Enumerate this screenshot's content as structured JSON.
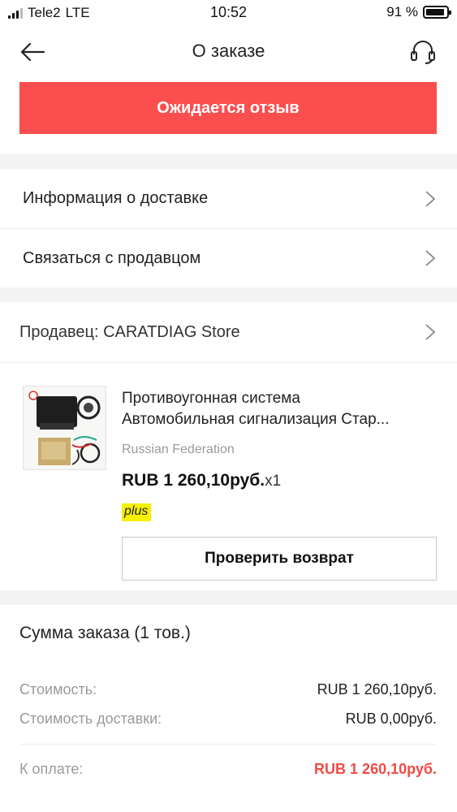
{
  "status_bar": {
    "carrier": "Tele2",
    "network": "LTE",
    "time": "10:52",
    "battery": "91 %",
    "battery_level": 0.91
  },
  "header": {
    "title": "О заказе",
    "back_icon": "arrow-left-icon",
    "support_icon": "headset-icon"
  },
  "order_status": "Ожидается отзыв",
  "menu": {
    "delivery_info": "Информация о доставке",
    "contact_seller": "Связаться с продавцом"
  },
  "seller": {
    "label": "Продавец: CARATDIAG Store"
  },
  "product": {
    "title_line1": "Противоугонная система",
    "title_line2": "Автомобильная сигнализация Стар...",
    "origin": "Russian Federation",
    "price": "RUB 1 260,10руб.",
    "quantity": "x1",
    "badge": "plus",
    "check_return_label": "Проверить возврат"
  },
  "summary": {
    "title": "Сумма заказа (1 тов.)",
    "cost_label": "Стоимость:",
    "cost_value": "RUB 1 260,10руб.",
    "shipping_label": "Стоимость доставки:",
    "shipping_value": "RUB 0,00руб.",
    "total_label": "К оплате:",
    "total_value": "RUB 1 260,10руб."
  },
  "colors": {
    "accent": "#fb4e4e",
    "total": "#f24a44",
    "badge": "#f7f000"
  }
}
